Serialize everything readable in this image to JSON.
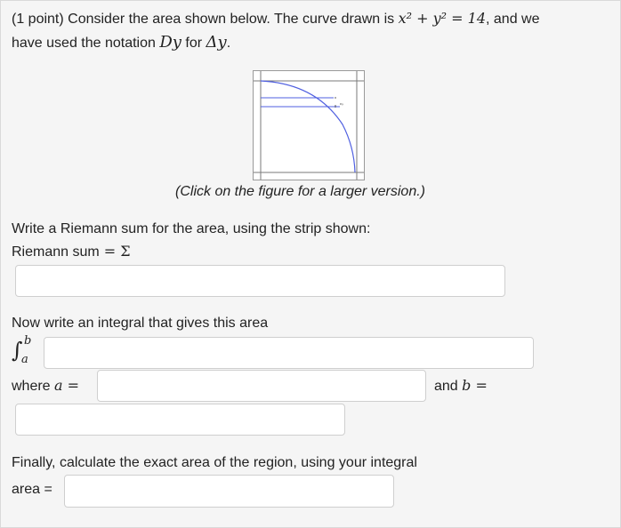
{
  "problem": {
    "intro_prefix": "(1 point) Consider the area shown below. The curve drawn is ",
    "curve_lhs": "x² + y² = 14",
    "intro_mid": ", and we",
    "intro_line2_prefix": "have used the notation ",
    "notation_dy": "Dy",
    "notation_for": " for ",
    "notation_delta": "Δy",
    "notation_end": "."
  },
  "figure": {
    "caption": "(Click on the figure for a larger version.)",
    "tiny_label": "Dy"
  },
  "riemann": {
    "prompt": "Write a Riemann sum for the area, using the strip shown:",
    "label": "Riemann sum",
    "eq": " = Σ",
    "value": ""
  },
  "integral": {
    "prompt": "Now write an integral that gives this area",
    "upper": "b",
    "lower": "a",
    "value": "",
    "where_label": "where ",
    "a_sym": "a",
    "eq": " = ",
    "a_value": "",
    "and_label": "and ",
    "b_sym": "b",
    "b_value": ""
  },
  "final": {
    "prompt": "Finally, calculate the exact area of the region, using your integral",
    "area_label": "area =",
    "area_value": ""
  },
  "colors": {
    "curve": "#4f5fe0",
    "panel_bg": "#f5f5f5",
    "field_border": "#cfcfcf"
  }
}
